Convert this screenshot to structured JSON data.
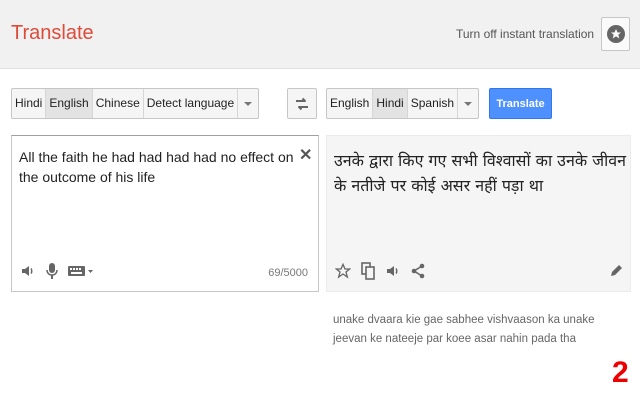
{
  "header": {
    "title": "Translate",
    "instant_toggle_label": "Turn off instant translation",
    "star_icon": "star-icon"
  },
  "source": {
    "languages": [
      "Hindi",
      "English",
      "Chinese",
      "Detect language"
    ],
    "selected": "English",
    "text": "All the faith he had had had had no effect on the outcome of his life",
    "char_count": "69/5000",
    "icons": [
      "speaker-icon",
      "microphone-icon",
      "keyboard-icon"
    ]
  },
  "target": {
    "languages": [
      "English",
      "Hindi",
      "Spanish"
    ],
    "selected": "Hindi",
    "translate_label": "Translate",
    "text": "उनके द्वारा किए गए सभी विश्वासों का उनके जीवन के नतीजे पर कोई असर नहीं पड़ा था",
    "romanized": "unake dvaara kie gae sabhee vishvaason ka unake jeevan ke nateeje par koee asar nahin pada tha",
    "icons": [
      "star-outline-icon",
      "copy-icon",
      "speaker-icon",
      "share-icon",
      "edit-icon"
    ]
  },
  "overlay": {
    "corner_mark": "2"
  },
  "colors": {
    "title": "#dd4b39",
    "translate_button": "#4d90fe",
    "corner_mark": "#ee0000"
  }
}
